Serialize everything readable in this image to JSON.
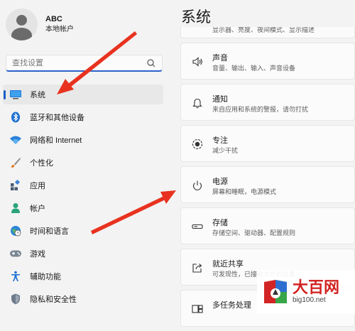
{
  "profile": {
    "name": "ABC",
    "account_type": "本地帐户"
  },
  "search": {
    "placeholder": "查找设置"
  },
  "sidebar": {
    "items": [
      {
        "label": "系统",
        "icon": "monitor-icon",
        "active": true
      },
      {
        "label": "蓝牙和其他设备",
        "icon": "bluetooth-icon"
      },
      {
        "label": "网络和 Internet",
        "icon": "wifi-icon"
      },
      {
        "label": "个性化",
        "icon": "brush-icon"
      },
      {
        "label": "应用",
        "icon": "apps-icon"
      },
      {
        "label": "帐户",
        "icon": "person-icon"
      },
      {
        "label": "时间和语言",
        "icon": "globe-clock-icon"
      },
      {
        "label": "游戏",
        "icon": "gamepad-icon"
      },
      {
        "label": "辅助功能",
        "icon": "accessibility-icon"
      },
      {
        "label": "隐私和安全性",
        "icon": "shield-icon"
      }
    ]
  },
  "main": {
    "title": "系统",
    "partial_card_sub": "显示器、亮度、夜间模式、显示描述",
    "cards": [
      {
        "title": "声音",
        "sub": "音量、输出、输入、声音设备",
        "icon": "speaker-icon"
      },
      {
        "title": "通知",
        "sub": "来自应用和系统的警报，请勿打扰",
        "icon": "bell-icon"
      },
      {
        "title": "专注",
        "sub": "减少干扰",
        "icon": "focus-icon"
      },
      {
        "title": "电源",
        "sub": "屏幕和睡眠，电源模式",
        "icon": "power-icon"
      },
      {
        "title": "存储",
        "sub": "存储空间、驱动器、配置规则",
        "icon": "storage-icon"
      },
      {
        "title": "就近共享",
        "sub": "可发现性，已接收文件的位置",
        "icon": "share-icon"
      },
      {
        "title": "多任务处理",
        "sub": "",
        "icon": "multitask-icon"
      }
    ]
  },
  "watermark": {
    "title": "大百网",
    "url": "big100.net"
  },
  "colors": {
    "accent": "#1b5fc7",
    "arrow": "#e8321f",
    "watermark_red": "#d22424"
  }
}
